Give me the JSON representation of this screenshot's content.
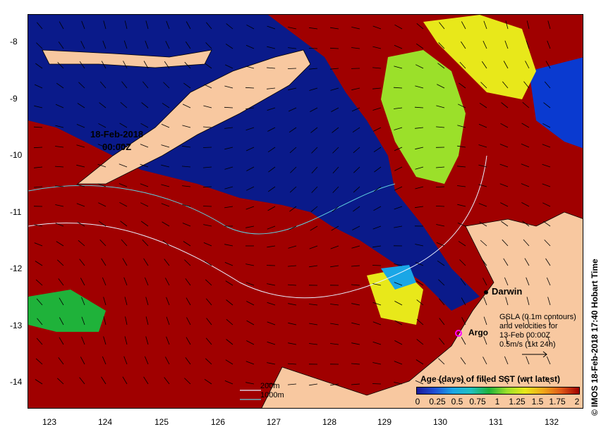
{
  "title": {
    "date_line1": "18-Feb-2018",
    "date_line2": "00:00Z"
  },
  "axes": {
    "x_ticks": [
      "123",
      "124",
      "125",
      "126",
      "127",
      "128",
      "129",
      "130",
      "131",
      "132"
    ],
    "y_ticks": [
      "-8",
      "-9",
      "-10",
      "-11",
      "-12",
      "-13",
      "-14"
    ]
  },
  "places": {
    "darwin": "Darwin",
    "argo": "Argo"
  },
  "gsla_note": {
    "line1": "GSLA (0.1m contours)",
    "line2": "and velocities for",
    "line3": "13-Feb 00:00Z",
    "line4": "0.5m/s (1kt 24h)"
  },
  "legend": {
    "title": "Age (days) of filled SST (wrt latest)",
    "ticks": [
      "0",
      "0.25",
      "0.5",
      "0.75",
      "1",
      "1.25",
      "1.5",
      "1.75",
      "2"
    ]
  },
  "contour_key": {
    "line1": "200m",
    "line2": "1000m"
  },
  "credit": "© IMOS 18-Feb-2018 17:40 Hobart Time",
  "colors": {
    "ocean_deep_red": "#a00000",
    "recent_blue": "#0a1a8a",
    "land": "#f8c8a0",
    "mid_green": "#9be02a",
    "yellow": "#e8e81a",
    "argo_marker": "#ff00ff"
  }
}
